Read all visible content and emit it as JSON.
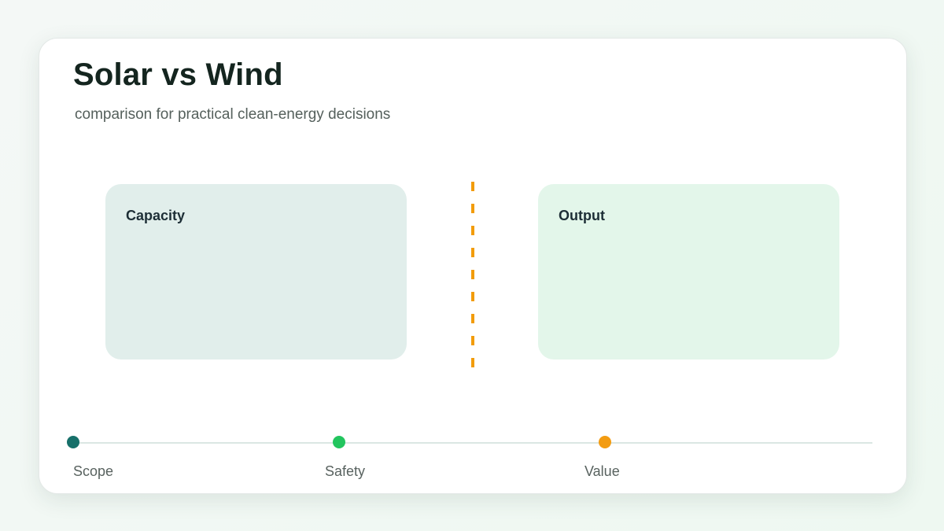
{
  "header": {
    "title": "Solar vs Wind",
    "subtitle": "comparison for practical clean-energy decisions"
  },
  "panels": {
    "left": {
      "label": "Capacity",
      "color": "#e1eeeb"
    },
    "right": {
      "label": "Output",
      "color": "#e3f6ea"
    }
  },
  "divider": {
    "color": "#f29c0b",
    "style": "dashed"
  },
  "timeline": {
    "steps": [
      {
        "label": "Scope",
        "color": "#17706a"
      },
      {
        "label": "Safety",
        "color": "#22c55e"
      },
      {
        "label": "Value",
        "color": "#f39c12"
      }
    ]
  }
}
